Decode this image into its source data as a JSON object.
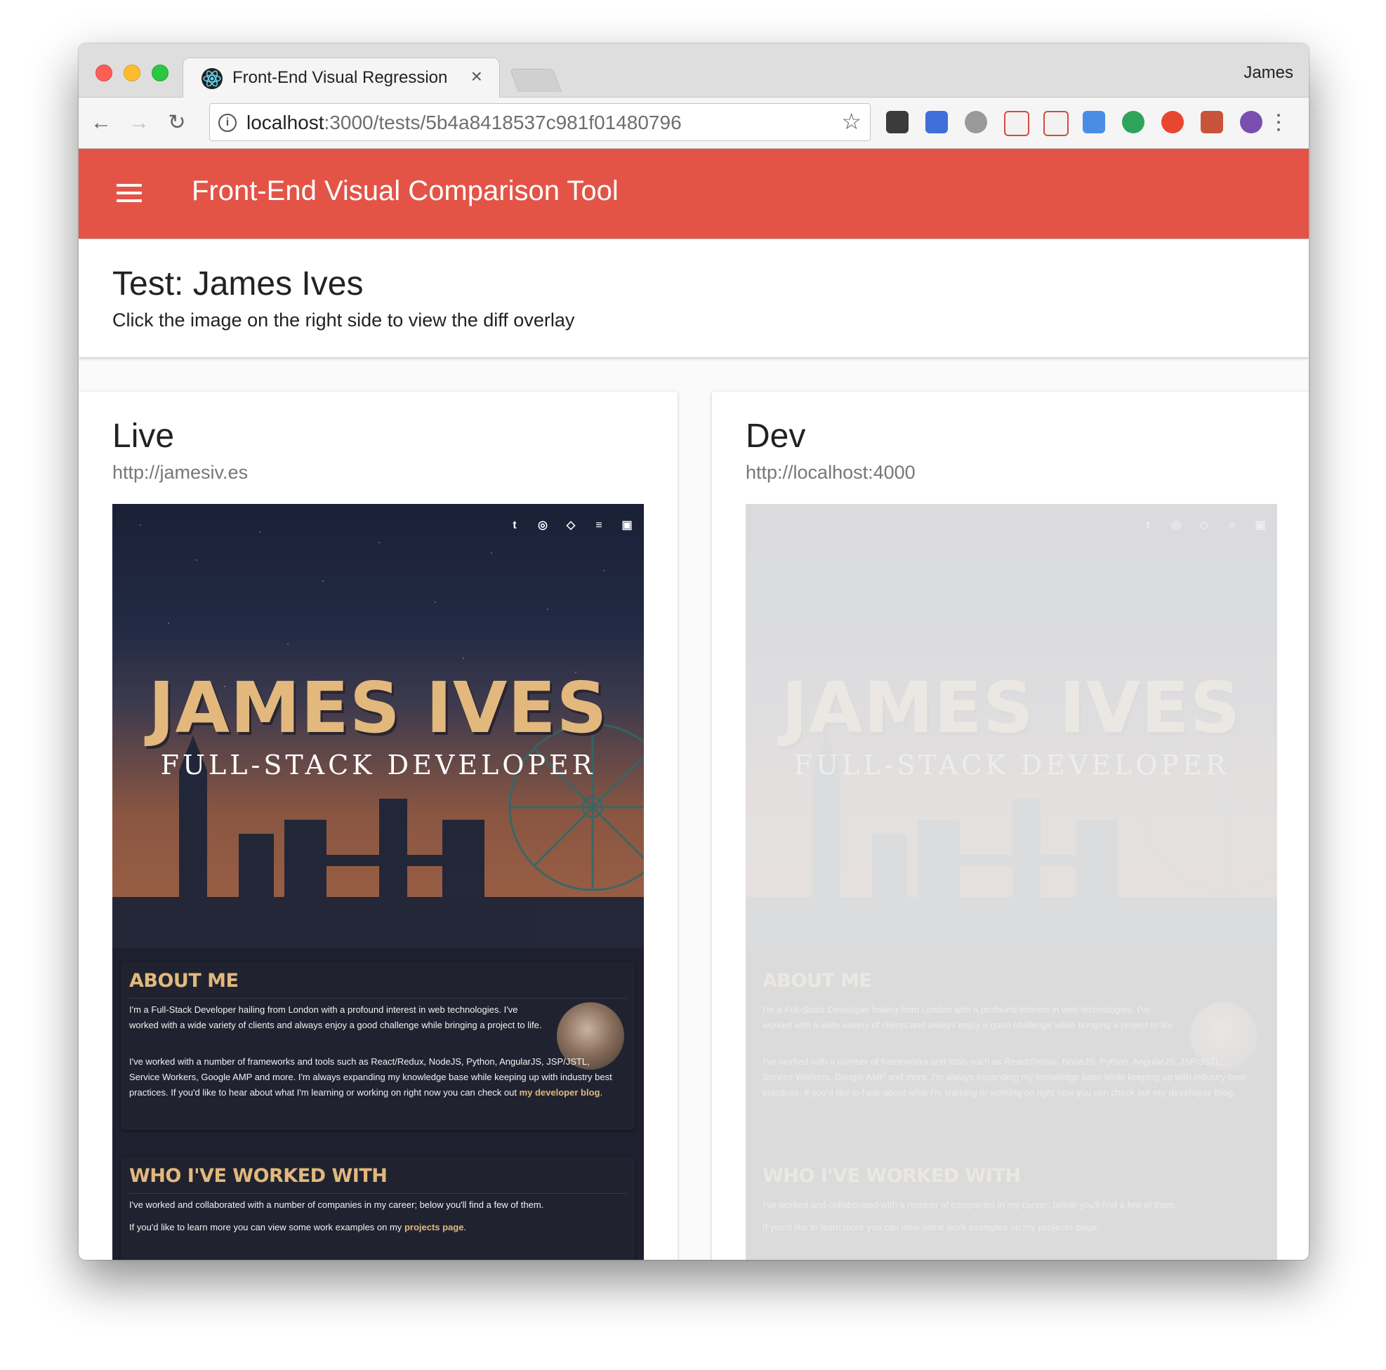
{
  "browser": {
    "tab_title": "Front-End Visual Regression",
    "tab_close": "×",
    "profile_name": "James",
    "url_host": "localhost",
    "url_path": ":3000/tests/5b4a8418537c981f01480796",
    "info_glyph": "i",
    "star_glyph": "☆",
    "back_glyph": "←",
    "forward_glyph": "→",
    "reload_glyph": "↻",
    "menu_glyph": "⋮",
    "extension_icons": [
      "lastpass-icon",
      "lighthouse-icon",
      "lightning-icon",
      "gmail-icon",
      "inbox-icon",
      "calendar-icon",
      "hangouts-icon",
      "adblock-icon",
      "react-devtools-icon",
      "privacy-badger-icon"
    ]
  },
  "app": {
    "title": "Front-End Visual Comparison Tool",
    "accent_color": "#e35447"
  },
  "header": {
    "title": "Test: James Ives",
    "subtitle": "Click the image on the right side to view the diff overlay"
  },
  "live": {
    "title": "Live",
    "url": "http://jamesiv.es"
  },
  "dev": {
    "title": "Dev",
    "url": "http://localhost:4000"
  },
  "site": {
    "social_icons": [
      "twitter-icon",
      "github-icon",
      "codepen-icon",
      "stackoverflow-icon",
      "linkedin-icon"
    ],
    "name": "JAMES IVES",
    "role": "FULL-STACK DEVELOPER",
    "about_title": "ABOUT ME",
    "about_p1": "I'm a Full-Stack Developer hailing from London with a profound interest in web technologies. I've worked with a wide variety of clients and always enjoy a good challenge while bringing a project to life.",
    "about_p2_text": "I've worked with a number of frameworks and tools such as React/Redux, NodeJS, Python, AngularJS, JSP/JSTL, Service Workers, Google AMP and more. I'm always expanding my knowledge base while keeping up with industry best practices. If you'd like to hear about what I'm learning or working on right now you can check out ",
    "about_p2_link": "my developer blog",
    "worked_title": "WHO I'VE WORKED WITH",
    "worked_p1": "I've worked and collaborated with a number of companies in my career; below you'll find a few of them.",
    "worked_p2_text": "If you'd like to learn more you can view some work examples on my ",
    "worked_p2_link": "projects page",
    "period": "."
  }
}
